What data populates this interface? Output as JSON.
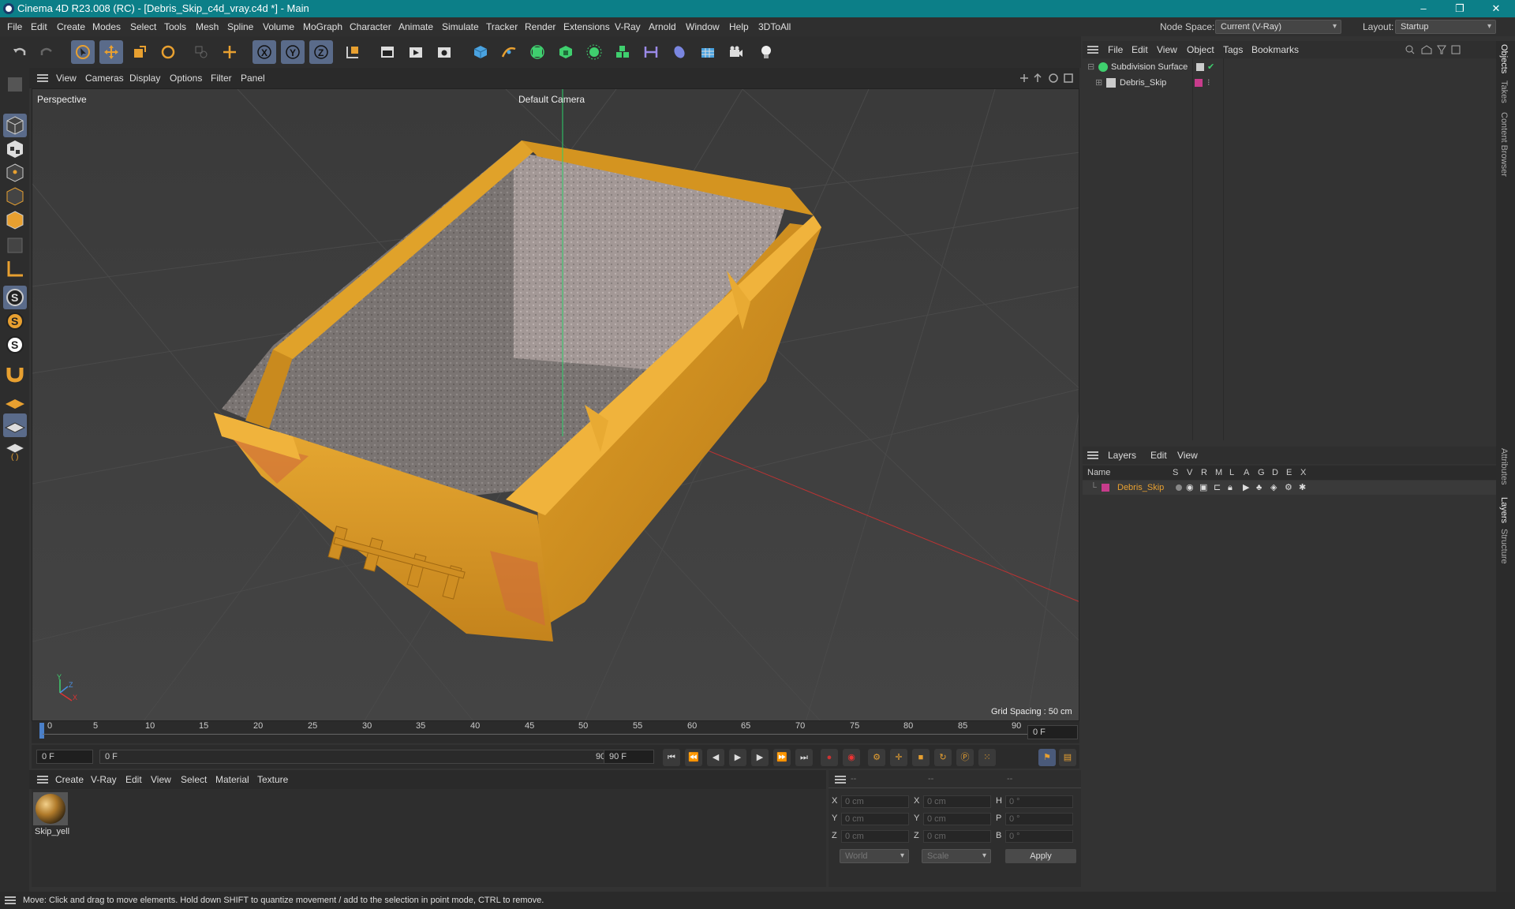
{
  "window": {
    "title": "Cinema 4D R23.008 (RC) - [Debris_Skip_c4d_vray.c4d *] - Main",
    "min": "–",
    "max": "❐",
    "close": "✕"
  },
  "menu": {
    "items": [
      "File",
      "Edit",
      "Create",
      "Modes",
      "Select",
      "Tools",
      "Mesh",
      "Spline",
      "Volume",
      "MoGraph",
      "Character",
      "Animate",
      "Simulate",
      "Tracker",
      "Render",
      "Extensions",
      "V-Ray",
      "Arnold",
      "Window",
      "Help",
      "3DToAll"
    ],
    "node_space_label": "Node Space:",
    "node_space_value": "Current (V-Ray)",
    "layout_label": "Layout:",
    "layout_value": "Startup"
  },
  "viewport": {
    "menu": [
      "View",
      "Cameras",
      "Display",
      "Options",
      "Filter",
      "Panel"
    ],
    "name": "Perspective",
    "camera": "Default Camera",
    "grid_spacing": "Grid Spacing : 50 cm",
    "axis_y": "Y",
    "axis_z": "Z",
    "axis_x": "X"
  },
  "timeline": {
    "ticks": [
      "0",
      "5",
      "10",
      "15",
      "20",
      "25",
      "30",
      "35",
      "40",
      "45",
      "50",
      "55",
      "60",
      "65",
      "70",
      "75",
      "80",
      "85",
      "90"
    ],
    "current_frame": "0 F"
  },
  "transport": {
    "start": "0 F",
    "range_start": "0 F",
    "range_end": "90 F",
    "end": "90 F"
  },
  "material_menu": [
    "Create",
    "V-Ray",
    "Edit",
    "View",
    "Select",
    "Material",
    "Texture"
  ],
  "materials": [
    {
      "name": "Skip_yell"
    }
  ],
  "coords": {
    "header": [
      "--",
      "--",
      "--"
    ],
    "rows": [
      {
        "a": "X",
        "av": "0 cm",
        "b": "X",
        "bv": "0 cm",
        "c": "H",
        "cv": "0 °"
      },
      {
        "a": "Y",
        "av": "0 cm",
        "b": "Y",
        "bv": "0 cm",
        "c": "P",
        "cv": "0 °"
      },
      {
        "a": "Z",
        "av": "0 cm",
        "b": "Z",
        "bv": "0 cm",
        "c": "B",
        "cv": "0 °"
      }
    ],
    "mode1": "World",
    "mode2": "Scale",
    "apply": "Apply"
  },
  "status": "Move: Click and drag to move elements. Hold down SHIFT to quantize movement / add to the selection in point mode, CTRL to remove.",
  "objects": {
    "menu": [
      "File",
      "Edit",
      "View",
      "Object",
      "Tags",
      "Bookmarks"
    ],
    "items": [
      {
        "name": "Subdivision Surface"
      },
      {
        "name": "Debris_Skip"
      }
    ]
  },
  "layers": {
    "menu": [
      "Layers",
      "Edit",
      "View"
    ],
    "columns": [
      "Name",
      "S",
      "V",
      "R",
      "M",
      "L",
      "A",
      "G",
      "D",
      "E",
      "X"
    ],
    "items": [
      {
        "name": "Debris_Skip",
        "color": "#c83c8c"
      }
    ]
  },
  "side_tabs": [
    "Objects",
    "Takes",
    "Content Browser",
    "Attributes",
    "Layers",
    "Structure"
  ],
  "colors": {
    "titlebar": "#0c7f88",
    "skip": "#d99a1f",
    "accent_orange": "#e8a030",
    "layer_color": "#c83c8c"
  }
}
